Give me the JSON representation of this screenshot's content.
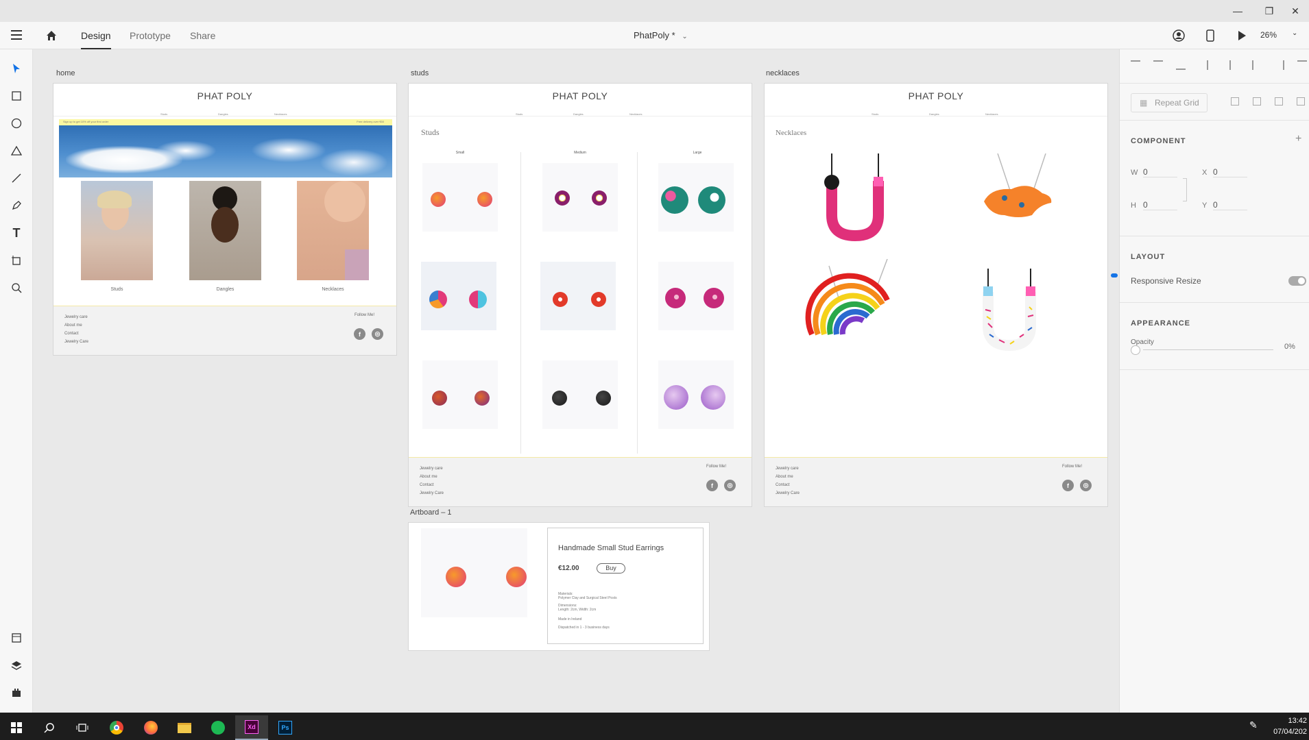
{
  "window": {
    "min": "—",
    "restore": "❐",
    "close": "✕"
  },
  "app": {
    "tabs": [
      "Design",
      "Prototype",
      "Share"
    ],
    "doc_title": "PhatPoly *",
    "zoom": "26%"
  },
  "artboards": {
    "home": {
      "label": "home",
      "brand": "PHAT POLY",
      "nav": [
        "Studs",
        "Dangles",
        "Necklaces"
      ],
      "banner_left": "Sign up to get 10% off your first order",
      "banner_right": "Free delivery over €50",
      "captions": [
        "Studs",
        "Dangles",
        "Necklaces"
      ]
    },
    "studs": {
      "label": "studs",
      "brand": "PHAT POLY",
      "nav": [
        "Studs",
        "Dangles",
        "Necklaces"
      ],
      "heading": "Studs",
      "columns": [
        "Small",
        "Medium",
        "Large"
      ]
    },
    "necklaces": {
      "label": "necklaces",
      "brand": "PHAT POLY",
      "nav": [
        "Studs",
        "Dangles",
        "Necklaces"
      ],
      "heading": "Necklaces"
    },
    "artboard1": {
      "label": "Artboard – 1",
      "product_title": "Handmade Small Stud Earrings",
      "price": "€12.00",
      "buy": "Buy",
      "details": [
        "Materials:",
        "Polymer Clay and Surgical Steel Posts",
        "Dimensions:",
        "Length: 2cm, Width: 2cm",
        "Made in Ireland",
        "Dispatched in 1 - 3 business days"
      ]
    }
  },
  "footer": {
    "links": [
      "Jewelry care",
      "About me",
      "Contact",
      "Jewelry Care"
    ],
    "follow": "Follow Me!"
  },
  "right_panel": {
    "repeat_grid": "Repeat Grid",
    "component": "COMPONENT",
    "w_label": "W",
    "w": "0",
    "h_label": "H",
    "h": "0",
    "x_label": "X",
    "x": "0",
    "y_label": "Y",
    "y": "0",
    "layout": "LAYOUT",
    "responsive": "Responsive Resize",
    "appearance": "APPEARANCE",
    "opacity_label": "Opacity",
    "opacity": "0%"
  },
  "taskbar": {
    "time": "13:42",
    "date": "07/04/202"
  },
  "colors": {
    "accent": "#1473e6",
    "banner_yellow": "#fbf7a0",
    "xd": "#470137",
    "ps": "#001e36"
  }
}
